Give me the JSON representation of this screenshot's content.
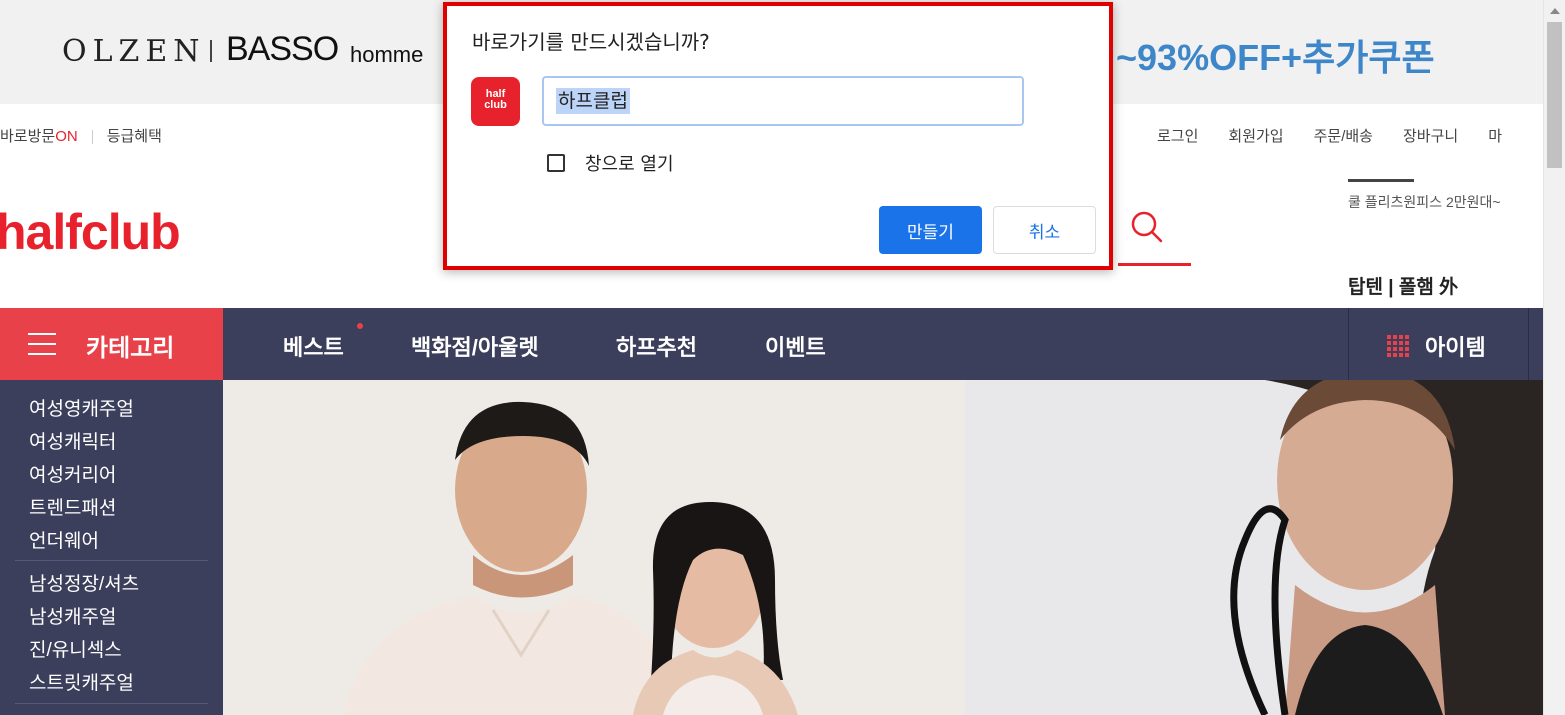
{
  "banner": {
    "brand1": "OLZEN",
    "brand2": "BASSO",
    "brand2_sub": "homme",
    "promo": "~93%OFF+추가쿠폰"
  },
  "util_left": {
    "visit_prefix": "바로방문",
    "visit_on": "ON",
    "benefits": "등급혜택"
  },
  "util_right": [
    "로그인",
    "회원가입",
    "주문/배송",
    "장바구니",
    "마"
  ],
  "logo": "halfclub",
  "right_promo": {
    "line1": "쿨 플리츠원피스 2만원대~",
    "line2": "탑텐 | 폴햄 外"
  },
  "nav": {
    "category": "카테고리",
    "items": [
      "베스트",
      "백화점/아울렛",
      "하프추천",
      "이벤트"
    ],
    "item_button": "아이템"
  },
  "sidebar": {
    "group1": [
      "여성영캐주얼",
      "여성캐릭터",
      "여성커리어",
      "트렌드패션",
      "언더웨어"
    ],
    "group2": [
      "남성정장/셔츠",
      "남성캐주얼",
      "진/유니섹스",
      "스트릿캐주얼"
    ]
  },
  "dialog": {
    "title": "바로가기를 만드시겠습니까?",
    "icon_text_line1": "half",
    "icon_text_line2": "club",
    "input_value": "하프클럽",
    "checkbox_label": "창으로 열기",
    "checkbox_checked": false,
    "create_button": "만들기",
    "cancel_button": "취소"
  },
  "colors": {
    "brand_red": "#e8222d",
    "nav_bg": "#3b3f5c",
    "primary_blue": "#1a73e8",
    "promo_blue": "#3d86c9"
  }
}
